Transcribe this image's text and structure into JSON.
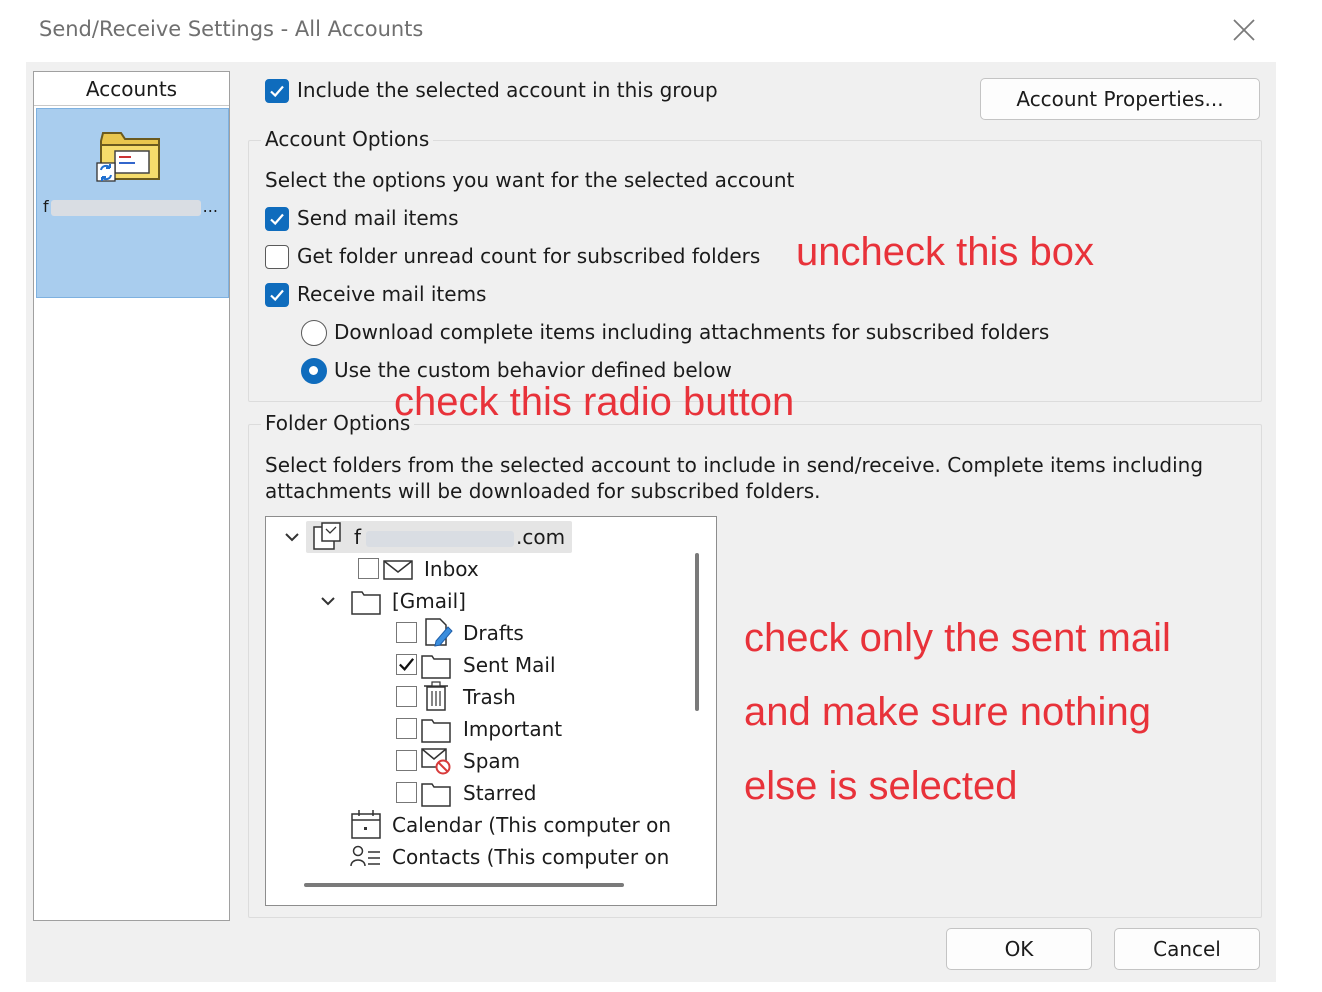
{
  "window": {
    "title": "Send/Receive Settings - All Accounts"
  },
  "accounts": {
    "header": "Accounts",
    "items": [
      {
        "label_prefix": "f",
        "label_suffix": "...",
        "selected": true,
        "icon": "account-folder-sync-icon"
      }
    ]
  },
  "include_group": {
    "label": "Include the selected account in this group",
    "checked": true
  },
  "account_properties_button": "Account Properties...",
  "account_options": {
    "title": "Account Options",
    "description": "Select the options you want for the selected account",
    "send_mail": {
      "label": "Send mail items",
      "checked": true
    },
    "unread_count": {
      "label": "Get folder unread count for subscribed folders",
      "checked": false
    },
    "receive_mail": {
      "label": "Receive mail items",
      "checked": true
    },
    "download_complete": {
      "label": "Download complete items including attachments for subscribed folders",
      "selected": false
    },
    "custom_behavior": {
      "label": "Use the custom behavior defined below",
      "selected": true
    }
  },
  "folder_options": {
    "title": "Folder Options",
    "description_line1": "Select folders from the selected account to include in send/receive. Complete items including",
    "description_line2": "attachments will be downloaded for subscribed folders.",
    "tree": {
      "root": {
        "prefix": "f",
        "suffix": ".com",
        "expanded": true
      },
      "inbox": {
        "label": "Inbox",
        "checked": false
      },
      "gmail": {
        "label": "[Gmail]",
        "expanded": true
      },
      "children": [
        {
          "label": "Drafts",
          "checked": false,
          "icon": "drafts-icon"
        },
        {
          "label": "Sent Mail",
          "checked": true,
          "icon": "folder-icon"
        },
        {
          "label": "Trash",
          "checked": false,
          "icon": "trash-icon"
        },
        {
          "label": "Important",
          "checked": false,
          "icon": "folder-icon"
        },
        {
          "label": "Spam",
          "checked": false,
          "icon": "spam-icon"
        },
        {
          "label": "Starred",
          "checked": false,
          "icon": "folder-icon"
        }
      ],
      "calendar": "Calendar (This computer on",
      "contacts": "Contacts (This computer on"
    }
  },
  "buttons": {
    "ok": "OK",
    "cancel": "Cancel"
  },
  "annotations": {
    "uncheck": "uncheck this box",
    "radio": "check this radio button",
    "line1": "check only the sent mail",
    "line2": "and make sure nothing",
    "line3": "else is selected",
    "color": "#e8323a"
  },
  "colors": {
    "accent": "#0f6cbd",
    "selection": "#a9cdee",
    "dialog_bg": "#f0f0f0"
  }
}
